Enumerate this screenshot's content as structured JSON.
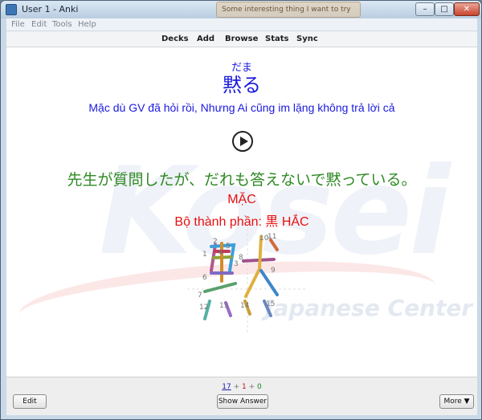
{
  "window": {
    "title": "User 1 - Anki",
    "background_tab": "Some interesting thing I want to try",
    "min_glyph": "–",
    "max_glyph": "□",
    "close_glyph": "✕"
  },
  "menu": [
    "File",
    "Edit",
    "Tools",
    "Help"
  ],
  "toolbar": [
    "Decks",
    "Add",
    "Browse",
    "Stats",
    "Sync"
  ],
  "card": {
    "reading": "だま",
    "word": "黙る",
    "meaning": "Mặc dù GV đã hỏi rồi, Nhưng Ai cũng im lặng không trả lời cả",
    "example": "先生が質問したが、だれも答えないで黙っている。",
    "han_viet": "MẶC",
    "components": "Bộ thành phần: 黒 HẮC",
    "watermark": "Kosei",
    "watermark_sub": "Japanese Center",
    "stroke_numbers": [
      "1",
      "2",
      "3",
      "4",
      "5",
      "6",
      "7",
      "8",
      "9",
      "10",
      "11",
      "12",
      "13",
      "14",
      "15"
    ]
  },
  "footer": {
    "count_new": "17",
    "count_learn": "1",
    "count_review": "0",
    "separator": "+",
    "edit_label": "Edit",
    "show_answer_label": "Show Answer",
    "more_label": "More ▼"
  },
  "colors": {
    "prompt_blue": "#1a1ae0",
    "example_green": "#2f8a25",
    "han_viet_red": "#e81010"
  }
}
